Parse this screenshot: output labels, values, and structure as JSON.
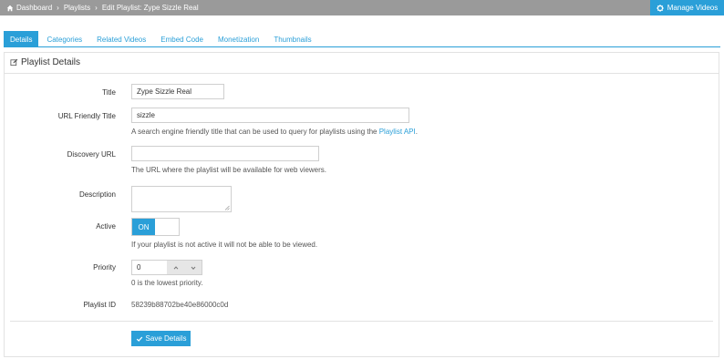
{
  "breadcrumb": {
    "icon": "home-icon",
    "items": [
      "Dashboard",
      "Playlists",
      "Edit Playlist: Zype Sizzle Real"
    ],
    "separator": "›"
  },
  "header": {
    "manage_videos_label": "Manage Videos",
    "manage_videos_icon": "gear-icon"
  },
  "tabs": [
    {
      "label": "Details",
      "active": true
    },
    {
      "label": "Categories",
      "active": false
    },
    {
      "label": "Related Videos",
      "active": false
    },
    {
      "label": "Embed Code",
      "active": false
    },
    {
      "label": "Monetization",
      "active": false
    },
    {
      "label": "Thumbnails",
      "active": false
    }
  ],
  "panel": {
    "title": "Playlist Details",
    "title_icon": "edit-icon"
  },
  "form": {
    "title": {
      "label": "Title",
      "value": "Zype Sizzle Real"
    },
    "url_title": {
      "label": "URL Friendly Title",
      "value": "sizzle",
      "help_prefix": "A search engine friendly title that can be used to query for playlists using the ",
      "help_link": "Playlist API",
      "help_suffix": "."
    },
    "discovery_url": {
      "label": "Discovery URL",
      "value": "",
      "help": "The URL where the playlist will be available for web viewers."
    },
    "description": {
      "label": "Description",
      "value": ""
    },
    "active": {
      "label": "Active",
      "state": "ON",
      "help": "If your playlist is not active it will not be able to be viewed."
    },
    "priority": {
      "label": "Priority",
      "value": "0",
      "help": "0 is the lowest priority."
    },
    "playlist_id": {
      "label": "Playlist ID",
      "value": "58239b88702be40e86000c0d"
    }
  },
  "save_label": "Save Details",
  "colors": {
    "accent": "#2a9fd8",
    "topbar": "#9a9a9a",
    "border": "#cfcfcf"
  }
}
